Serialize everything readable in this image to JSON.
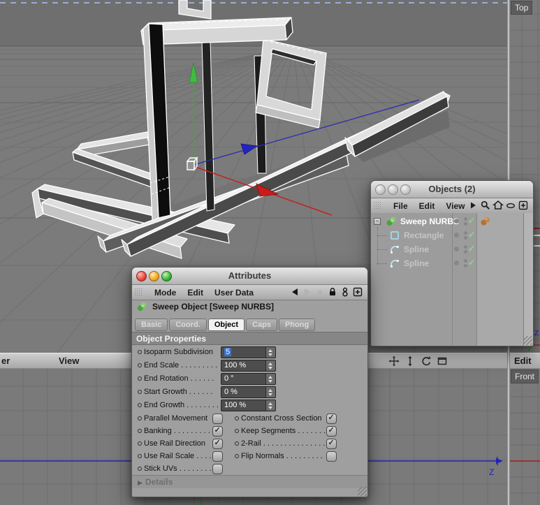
{
  "colors": {
    "selection_blue": "#3e73c8",
    "axis_x_red": "#c32222",
    "axis_y_green": "#3cab3c",
    "axis_z_blue": "#2828b4",
    "viewport_axis_blue": "#2222bb",
    "viewport_axis_red": "#9e1e1e",
    "object_icon_green": "#57b847",
    "spline_icon_blue": "#bfe4f0",
    "tag_orange": "#c98440",
    "check_green": "#8fd596",
    "active_border_blue": "#97aed3"
  },
  "right_viewport": {
    "label": "Top",
    "axis_label": "Z"
  },
  "bottom_left_viewport": {
    "axis_label": "Z"
  },
  "bottom_right_viewport": {
    "label": "Front"
  },
  "menubar": {
    "left_items": [
      "er",
      "View"
    ],
    "right_item": "Edit",
    "icons": [
      "pan-icon",
      "zoom-icon",
      "rotate-icon",
      "maximize-icon"
    ]
  },
  "objects_panel": {
    "title": "Objects (2)",
    "menu_items": [
      "File",
      "Edit",
      "View"
    ],
    "toolbar_icons": [
      "menu-arrow-icon",
      "search-icon",
      "home-icon",
      "oval-icon",
      "add-box-icon"
    ],
    "tree": [
      {
        "label": "Sweep NURBS",
        "icon": "sweep-nurbs",
        "level": 0,
        "selected": true,
        "expanded": true,
        "tags": [
          "phong-tag"
        ]
      },
      {
        "label": "Rectangle",
        "icon": "rectangle",
        "level": 1,
        "selected": false
      },
      {
        "label": "Spline",
        "icon": "spline",
        "level": 1,
        "selected": false
      },
      {
        "label": "Spline",
        "icon": "spline",
        "level": 1,
        "selected": false
      }
    ]
  },
  "attributes_panel": {
    "title": "Attributes",
    "menu_items": [
      "Mode",
      "Edit",
      "User Data"
    ],
    "nav_icons": [
      {
        "name": "back-icon",
        "enabled": true
      },
      {
        "name": "forward-icon",
        "enabled": false
      },
      {
        "name": "up-icon",
        "enabled": false
      },
      {
        "name": "lock-icon",
        "enabled": true
      },
      {
        "name": "link-icon",
        "enabled": true
      },
      {
        "name": "add-box-icon",
        "enabled": true
      }
    ],
    "object_header": {
      "icon": "sweep-nurbs",
      "label": "Sweep Object [Sweep NURBS]"
    },
    "tabs": [
      "Basic",
      "Coord.",
      "Object",
      "Caps",
      "Phong"
    ],
    "active_tab": "Object",
    "section_title": "Object Properties",
    "value_fields": [
      {
        "label": "Isoparm Subdivision",
        "value": "5",
        "value_selected": true
      },
      {
        "label": "End Scale . . . . . . . . .",
        "value": "100 %",
        "value_selected": false
      },
      {
        "label": "End Rotation . . . . . .",
        "value": "0 °",
        "value_selected": false
      },
      {
        "label": "Start Growth . . . . . .",
        "value": "0 %",
        "value_selected": false
      },
      {
        "label": "End Growth . . . . . . . .",
        "value": "100 %",
        "value_selected": false
      }
    ],
    "check_fields_left": [
      {
        "label": "Parallel Movement",
        "checked": false
      },
      {
        "label": "Banking . . . . . . . . .",
        "checked": true
      },
      {
        "label": "Use Rail Direction",
        "checked": true
      },
      {
        "label": "Use Rail Scale . . . .",
        "checked": false
      },
      {
        "label": "Stick UVs . . . . . . . .",
        "checked": false
      }
    ],
    "check_fields_right": [
      {
        "label": "Constant Cross Section",
        "checked": true
      },
      {
        "label": "Keep Segments . . . . . . .",
        "checked": true
      },
      {
        "label": "2-Rail . . . . . . . . . . . . . . .",
        "checked": true
      },
      {
        "label": "Flip Normals . . . . . . . . .",
        "checked": false
      }
    ],
    "details_label": "Details"
  }
}
